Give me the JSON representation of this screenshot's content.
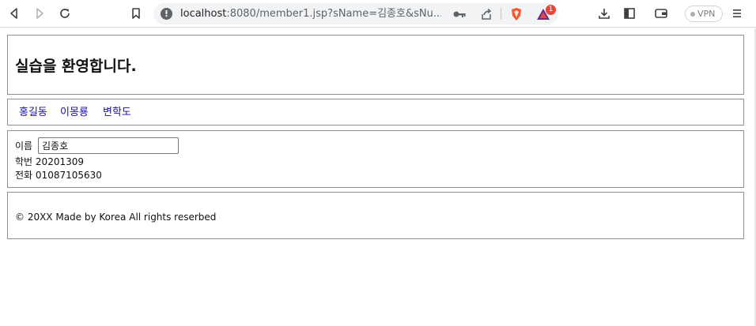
{
  "browser": {
    "url_host": "localhost",
    "url_rest": ":8080/member1.jsp?sName=김종호&sNu...",
    "extension_badge": "1",
    "vpn_label": "VPN"
  },
  "page": {
    "heading": "실습을 환영합니다.",
    "nav": [
      "홍길동",
      "이몽룡",
      "변학도"
    ],
    "name_label": "이름",
    "name_value": "김종호",
    "id_label": "학번",
    "id_value": "20201309",
    "phone_label": "전화",
    "phone_value": "01087105630",
    "footer": "© 20XX Made by Korea All rights reserbed"
  },
  "colors": {
    "link": "#1a0dab",
    "border": "#8f8f8f",
    "brave": "#fb542b",
    "badge": "#e8453c"
  }
}
